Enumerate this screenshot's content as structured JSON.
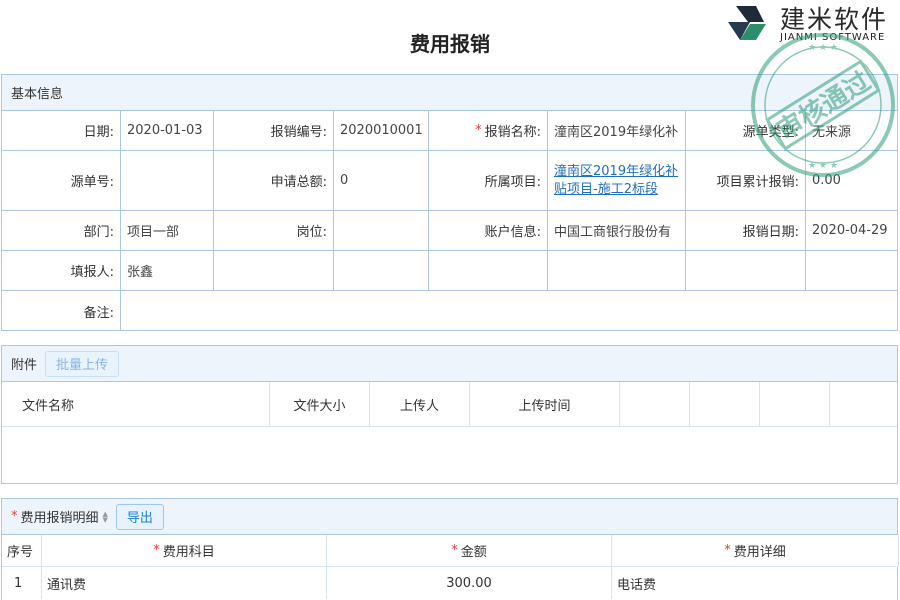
{
  "page_title": "费用报销",
  "logo": {
    "cn": "建米软件",
    "en": "JIANMI SOFTWARE"
  },
  "stamp": {
    "text": "审核通过"
  },
  "basic_info": {
    "title": "基本信息",
    "date_label": "日期:",
    "date_value": "2020-01-03",
    "code_label": "报销编号:",
    "code_value": "2020010001",
    "name_label": "报销名称:",
    "name_value": "潼南区2019年绿化补",
    "source_type_label": "源单类型:",
    "source_type_value": "无来源",
    "source_no_label": "源单号:",
    "source_no_value": "",
    "total_label": "申请总额:",
    "total_value": "0",
    "project_label": "所属项目:",
    "project_value": "潼南区2019年绿化补贴项目-施工2标段",
    "cumulative_label": "项目累计报销:",
    "cumulative_value": "0.00",
    "dept_label": "部门:",
    "dept_value": "项目一部",
    "post_label": "岗位:",
    "post_value": "",
    "account_label": "账户信息:",
    "account_value": "中国工商银行股份有",
    "reimb_date_label": "报销日期:",
    "reimb_date_value": "2020-04-29",
    "filler_label": "填报人:",
    "filler_value": "张鑫",
    "note_label": "备注:",
    "note_value": ""
  },
  "attachment": {
    "title": "附件",
    "upload_button": "批量上传",
    "columns": [
      "文件名称",
      "文件大小",
      "上传人",
      "上传时间",
      "",
      "",
      "",
      ""
    ]
  },
  "details": {
    "title": "费用报销明细",
    "export_button": "导出",
    "columns": [
      "序号",
      "费用科目",
      "金额",
      "费用详细"
    ],
    "rows": [
      {
        "index": "1",
        "subject": "通讯费",
        "amount": "300.00",
        "detail": "电话费"
      }
    ]
  },
  "colors": {
    "border": "#aac8e3",
    "header_bg": "#eef4fb",
    "link": "#1f6fc2",
    "required": "#e53935",
    "stamp": "#2e9e7a"
  }
}
